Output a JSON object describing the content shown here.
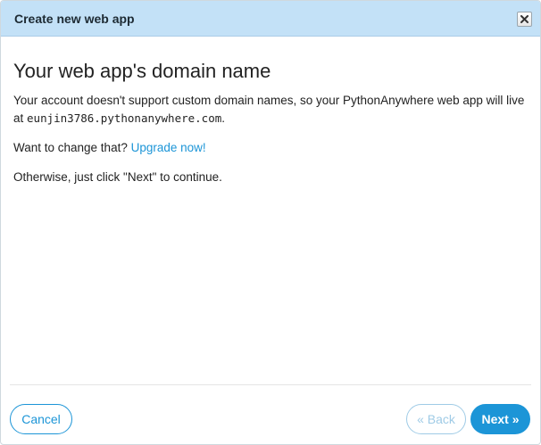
{
  "dialog": {
    "title": "Create new web app",
    "close_icon": "close-icon"
  },
  "content": {
    "heading": "Your web app's domain name",
    "line1_before": "Your account doesn't support custom domain names, so your PythonAnywhere web app will live at ",
    "domain": "eunjin3786.pythonanywhere.com",
    "line1_after": ".",
    "line2_before": "Want to change that? ",
    "upgrade_link": "Upgrade now!",
    "line3": "Otherwise, just click \"Next\" to continue."
  },
  "footer": {
    "cancel_label": "Cancel",
    "back_label": "« Back",
    "next_label": "Next »"
  },
  "colors": {
    "titlebar_bg": "#c3e1f7",
    "accent": "#1c95d7",
    "disabled": "#9fcbe6"
  }
}
